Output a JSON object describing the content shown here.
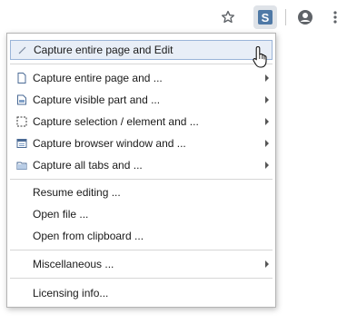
{
  "toolbar": {
    "icons": [
      "star-icon",
      "extension-s-icon",
      "profile-icon",
      "more-vertical-icon"
    ],
    "extension_letter": "S",
    "accent": "#5a7fa6"
  },
  "menu": {
    "items": [
      {
        "label": "Capture entire page and Edit",
        "icon": "pencil-icon",
        "submenu": false,
        "highlighted": true
      },
      {
        "label": "Capture entire page and ...",
        "icon": "page-icon",
        "submenu": true
      },
      {
        "label": "Capture visible part and ...",
        "icon": "visible-part-icon",
        "submenu": true
      },
      {
        "label": "Capture selection / element and ...",
        "icon": "selection-icon",
        "submenu": true
      },
      {
        "label": "Capture browser window and ...",
        "icon": "window-icon",
        "submenu": true
      },
      {
        "label": "Capture all tabs and ...",
        "icon": "tabs-icon",
        "submenu": true
      },
      {
        "label": "Resume editing ...",
        "submenu": false
      },
      {
        "label": "Open file ...",
        "submenu": false
      },
      {
        "label": "Open from clipboard ...",
        "submenu": false
      },
      {
        "label": "Miscellaneous ...",
        "submenu": true
      },
      {
        "label": "Licensing info...",
        "submenu": false
      }
    ],
    "highlight_color": "#e8eef7"
  }
}
